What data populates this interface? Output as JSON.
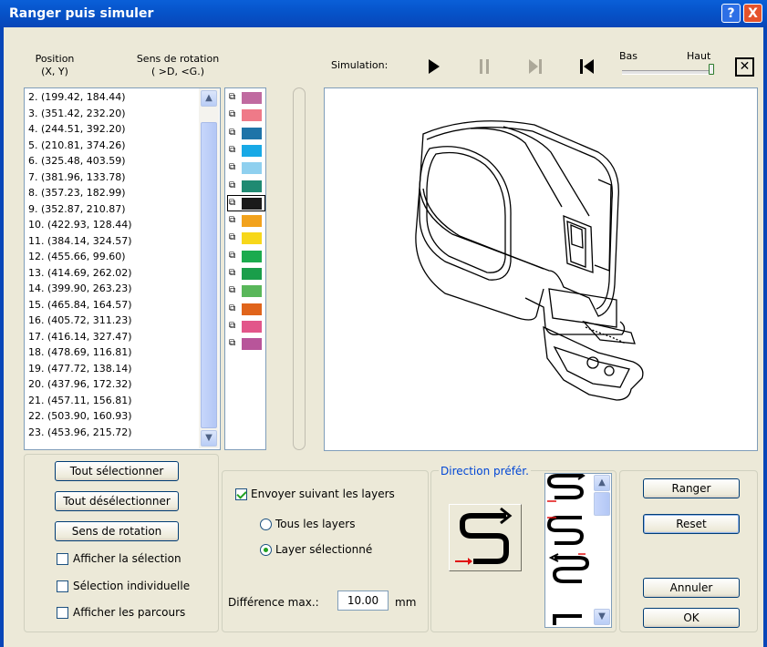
{
  "window": {
    "title": "Ranger puis simuler",
    "help_label": "?",
    "close_label": "X"
  },
  "list_header": {
    "position": "Position",
    "position_sub": "(X, Y)",
    "rotation": "Sens de rotation",
    "rotation_sub": "( >D, <G.)"
  },
  "points": [
    {
      "label": "2. (199.42, 184.44)",
      "dir": ">",
      "color": "#c06aa0"
    },
    {
      "label": "3. (351.42, 232.20)",
      "dir": ">",
      "color": "#ef7a88"
    },
    {
      "label": "4. (244.51, 392.20)",
      "dir": ">",
      "color": "#1f74a8"
    },
    {
      "label": "5. (210.81, 374.26)",
      "dir": ">",
      "color": "#18a9e6"
    },
    {
      "label": "6. (325.48, 403.59)",
      "dir": ">",
      "color": "#8fd0ef"
    },
    {
      "label": "7. (381.96, 133.78)",
      "dir": ">",
      "color": "#1f8a72"
    },
    {
      "label": "8. (357.23, 182.99)",
      "dir": ">",
      "color": "#1a1a1a"
    },
    {
      "label": "9. (352.87, 210.87)",
      "dir": ">",
      "color": "#f2a21c"
    },
    {
      "label": "10. (422.93, 128.44)",
      "dir": ">",
      "color": "#f7d71a"
    },
    {
      "label": "11. (384.14, 324.57)",
      "dir": ">",
      "color": "#1bab4e"
    },
    {
      "label": "12. (455.66, 99.60)",
      "dir": ">",
      "color": "#1a9e4a"
    },
    {
      "label": "13. (414.69, 262.02)",
      "dir": ">",
      "color": "#59b75a"
    },
    {
      "label": "14. (399.90, 263.23)",
      "dir": ">",
      "color": "#e0641b"
    },
    {
      "label": "15. (465.84, 164.57)",
      "dir": ">",
      "color": "#e2568a"
    },
    {
      "label": "16. (405.72, 311.23)",
      "dir": ">",
      "color": "#b8559a"
    },
    {
      "label": "17. (416.14, 327.47)",
      "dir": ">"
    },
    {
      "label": "18. (478.69, 116.81)",
      "dir": ">"
    },
    {
      "label": "19. (477.72, 138.14)",
      "dir": ">"
    },
    {
      "label": "20. (437.96, 172.32)",
      "dir": ">"
    },
    {
      "label": "21. (457.11, 156.81)",
      "dir": ">"
    },
    {
      "label": "22. (503.90, 160.93)",
      "dir": ">"
    },
    {
      "label": "23. (453.96, 215.72)",
      "dir": ">"
    }
  ],
  "simulation": {
    "label": "Simulation:",
    "speed_low": "Bas",
    "speed_high": "Haut",
    "speed_level": 1.0
  },
  "buttons": {
    "select_all": "Tout sélectionner",
    "deselect_all": "Tout désélectionner",
    "rotation": "Sens de rotation",
    "ranger": "Ranger",
    "reset": "Reset",
    "annuler": "Annuler",
    "ok": "OK"
  },
  "options": {
    "show_selection": "Afficher la sélection",
    "individual_selection": "Sélection individuelle",
    "show_paths": "Afficher les parcours",
    "send_by_layers": "Envoyer suivant les layers",
    "all_layers": "Tous les layers",
    "selected_layer": "Layer sélectionné",
    "max_diff_label": "Différence max.:",
    "max_diff_value": "10.00",
    "max_diff_unit": "mm"
  },
  "direction": {
    "title": "Direction préfér."
  },
  "colors": {
    "accent": "#21a121",
    "titlebar": "#0653c9",
    "arrow_red": "#e01010"
  }
}
